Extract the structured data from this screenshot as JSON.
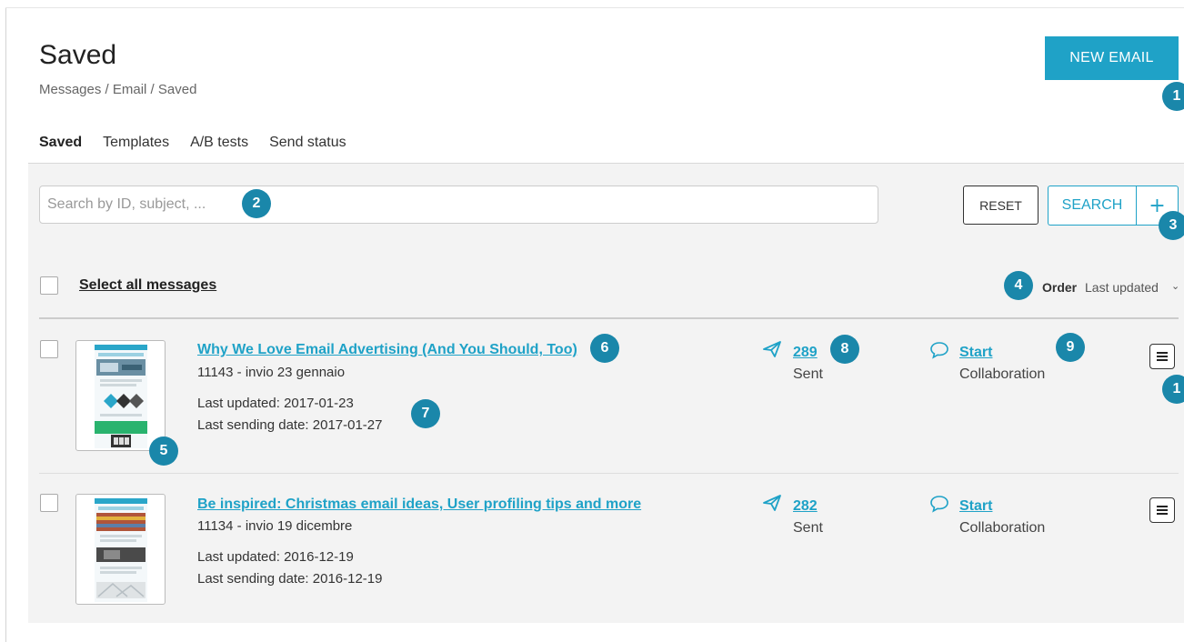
{
  "header": {
    "title": "Saved",
    "breadcrumb": "Messages / Email / Saved",
    "new_email_label": "NEW EMAIL"
  },
  "tabs": [
    {
      "label": "Saved",
      "active": true
    },
    {
      "label": "Templates",
      "active": false
    },
    {
      "label": "A/B tests",
      "active": false
    },
    {
      "label": "Send status",
      "active": false
    }
  ],
  "search": {
    "placeholder": "Search by ID, subject, ...",
    "value": "",
    "reset_label": "RESET",
    "search_label": "SEARCH",
    "plus_label": "+"
  },
  "list_header": {
    "select_all_label": "Select all messages",
    "order_label": "Order",
    "order_value": "Last updated",
    "chevron": "⌄"
  },
  "messages": [
    {
      "title": "Why We Love Email Advertising (And You Should, Too)",
      "subtitle": "11143 - invio 23 gennaio",
      "last_updated": "Last updated: 2017-01-23",
      "last_sending": "Last sending date: 2017-01-27",
      "sent_count": "289",
      "sent_label": "Sent",
      "collab_start": "Start",
      "collab_label": "Collaboration"
    },
    {
      "title": "Be inspired: Christmas email ideas, User profiling tips and more",
      "subtitle": "11134 - invio 19 dicembre",
      "last_updated": "Last updated: 2016-12-19",
      "last_sending": "Last sending date: 2016-12-19",
      "sent_count": "282",
      "sent_label": "Sent",
      "collab_start": "Start",
      "collab_label": "Collaboration"
    }
  ],
  "badges": [
    "1",
    "2",
    "3",
    "4",
    "5",
    "6",
    "7",
    "8",
    "9",
    "1"
  ],
  "colors": {
    "accent": "#1fa2c7",
    "badge": "#1a87aa",
    "panel_bg": "#f3f3f3"
  }
}
